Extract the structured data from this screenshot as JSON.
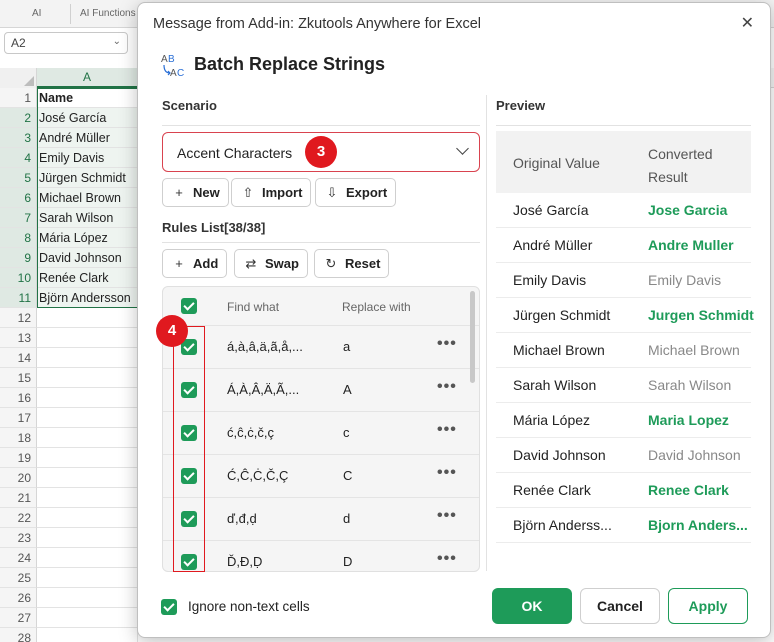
{
  "excel": {
    "tabs": [
      "AI",
      "AI Functions"
    ],
    "name_box": "A2",
    "column_header": "A",
    "rows": [
      {
        "num": "1",
        "value": "Name"
      },
      {
        "num": "2",
        "value": "José García"
      },
      {
        "num": "3",
        "value": "André Müller"
      },
      {
        "num": "4",
        "value": "Emily Davis"
      },
      {
        "num": "5",
        "value": "Jürgen Schmidt"
      },
      {
        "num": "6",
        "value": "Michael Brown"
      },
      {
        "num": "7",
        "value": "Sarah Wilson"
      },
      {
        "num": "8",
        "value": "Mária López"
      },
      {
        "num": "9",
        "value": "David Johnson"
      },
      {
        "num": "10",
        "value": "Renée Clark"
      },
      {
        "num": "11",
        "value": "Björn Andersson"
      },
      {
        "num": "12",
        "value": ""
      },
      {
        "num": "13",
        "value": ""
      },
      {
        "num": "14",
        "value": ""
      },
      {
        "num": "15",
        "value": ""
      },
      {
        "num": "16",
        "value": ""
      },
      {
        "num": "17",
        "value": ""
      },
      {
        "num": "18",
        "value": ""
      },
      {
        "num": "19",
        "value": ""
      },
      {
        "num": "20",
        "value": ""
      },
      {
        "num": "21",
        "value": ""
      },
      {
        "num": "22",
        "value": ""
      },
      {
        "num": "23",
        "value": ""
      },
      {
        "num": "24",
        "value": ""
      },
      {
        "num": "25",
        "value": ""
      },
      {
        "num": "26",
        "value": ""
      },
      {
        "num": "27",
        "value": ""
      },
      {
        "num": "28",
        "value": ""
      }
    ]
  },
  "dialog": {
    "title": "Message from Add-in: Zkutools Anywhere for Excel",
    "close_glyph": "✕",
    "brand_title": "Batch Replace Strings",
    "scenario_label": "Scenario",
    "scenario_value": "Accent Characters",
    "badge_3": "3",
    "badge_4": "4",
    "scenario_buttons": [
      {
        "label": "New",
        "icon": "+"
      },
      {
        "label": "Import",
        "icon": "⇧"
      },
      {
        "label": "Export",
        "icon": "⇩"
      }
    ],
    "rules_label": "Rules List[38/38]",
    "rules_buttons": [
      {
        "label": "Add",
        "icon": "+"
      },
      {
        "label": "Swap",
        "icon": "⇄"
      },
      {
        "label": "Reset",
        "icon": "↻"
      }
    ],
    "rules_headers": {
      "find": "Find what",
      "replace": "Replace with"
    },
    "rules": [
      {
        "find": "á,à,â,ä,ã,å,...",
        "replace": "a"
      },
      {
        "find": "Á,À,Â,Ä,Ã,...",
        "replace": "A"
      },
      {
        "find": "ć,ĉ,ċ,č,ç",
        "replace": "c"
      },
      {
        "find": "Ć,Ĉ,Ċ,Č,Ç",
        "replace": "C"
      },
      {
        "find": "ď,đ,ḍ",
        "replace": "d"
      },
      {
        "find": "Ď,Đ,Ḍ",
        "replace": "D"
      }
    ],
    "more_glyph": "•••",
    "preview_label": "Preview",
    "preview_headers": {
      "original": "Original Value",
      "converted": "Converted Result"
    },
    "preview_rows": [
      {
        "original": "José García",
        "converted": "Jose Garcia",
        "changed": true
      },
      {
        "original": "André Müller",
        "converted": "Andre Muller",
        "changed": true
      },
      {
        "original": "Emily Davis",
        "converted": "Emily Davis",
        "changed": false
      },
      {
        "original": "Jürgen Schmidt",
        "converted": "Jurgen Schmidt",
        "changed": true
      },
      {
        "original": "Michael Brown",
        "converted": "Michael Brown",
        "changed": false
      },
      {
        "original": "Sarah Wilson",
        "converted": "Sarah Wilson",
        "changed": false
      },
      {
        "original": "Mária López",
        "converted": "Maria Lopez",
        "changed": true
      },
      {
        "original": "David Johnson",
        "converted": "David Johnson",
        "changed": false
      },
      {
        "original": "Renée Clark",
        "converted": "Renee Clark",
        "changed": true
      },
      {
        "original": "Björn Anderss...",
        "converted": "Bjorn Anders...",
        "changed": true
      }
    ],
    "ignore_label": "Ignore non-text cells",
    "ok_label": "OK",
    "cancel_label": "Cancel",
    "apply_label": "Apply"
  },
  "colors": {
    "accent_green": "#1e9b59",
    "excel_green": "#217346",
    "annotation_red": "#e0191f"
  }
}
